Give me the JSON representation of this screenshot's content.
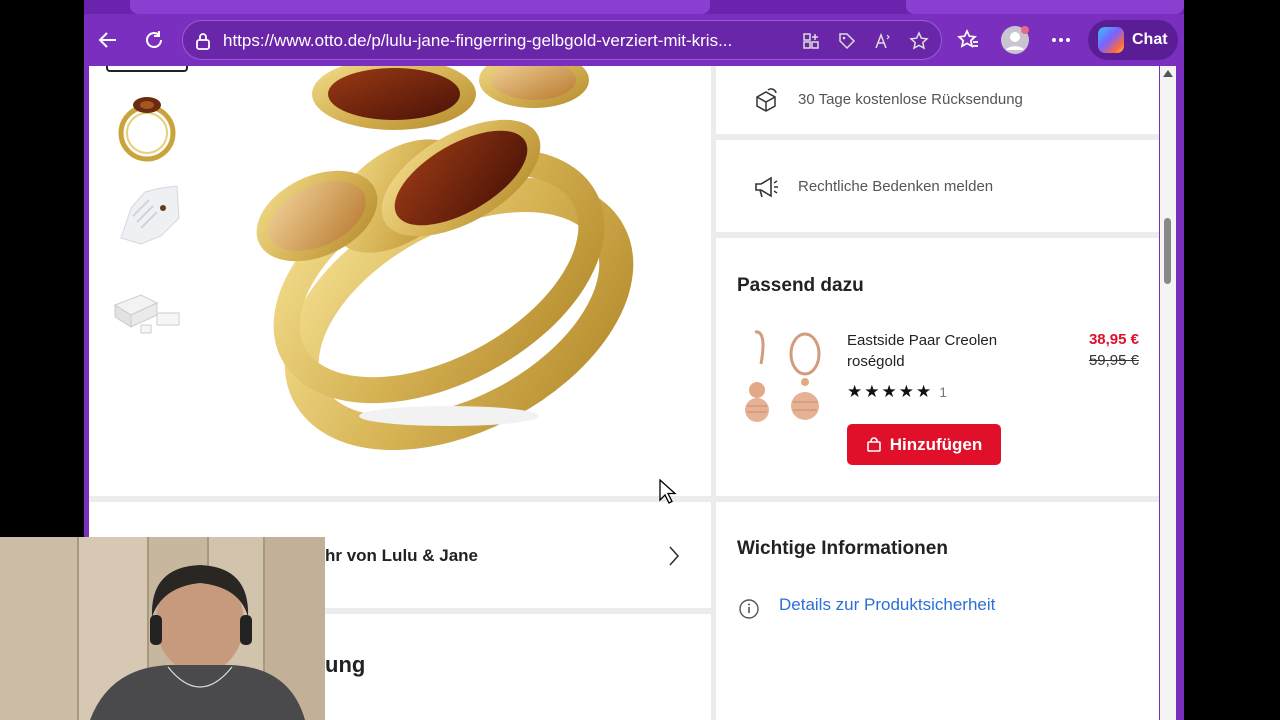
{
  "browser": {
    "url": "https://www.otto.de/p/lulu-jane-fingerring-gelbgold-verziert-mit-kris...",
    "chat_label": "Chat"
  },
  "service_rows": {
    "returns": "30 Tage kostenlose Rücksendung",
    "report": "Rechtliche Bedenken melden"
  },
  "passend": {
    "heading": "Passend dazu",
    "product_name": "Eastside Paar Creolen roségold",
    "price_new": "38,95 €",
    "price_old": "59,95 €",
    "rating": 5,
    "rating_count": "1",
    "add_label": "Hinzufügen"
  },
  "brand_row": {
    "label": "hr von Lulu & Jane"
  },
  "description": {
    "heading_fragment": "ung"
  },
  "info": {
    "heading": "Wichtige Informationen",
    "link": "Details zur Produktsicherheit"
  },
  "colors": {
    "browser_chrome": "#7b2fbf",
    "accent_red": "#e0102a",
    "link_blue": "#2b6fd6"
  }
}
